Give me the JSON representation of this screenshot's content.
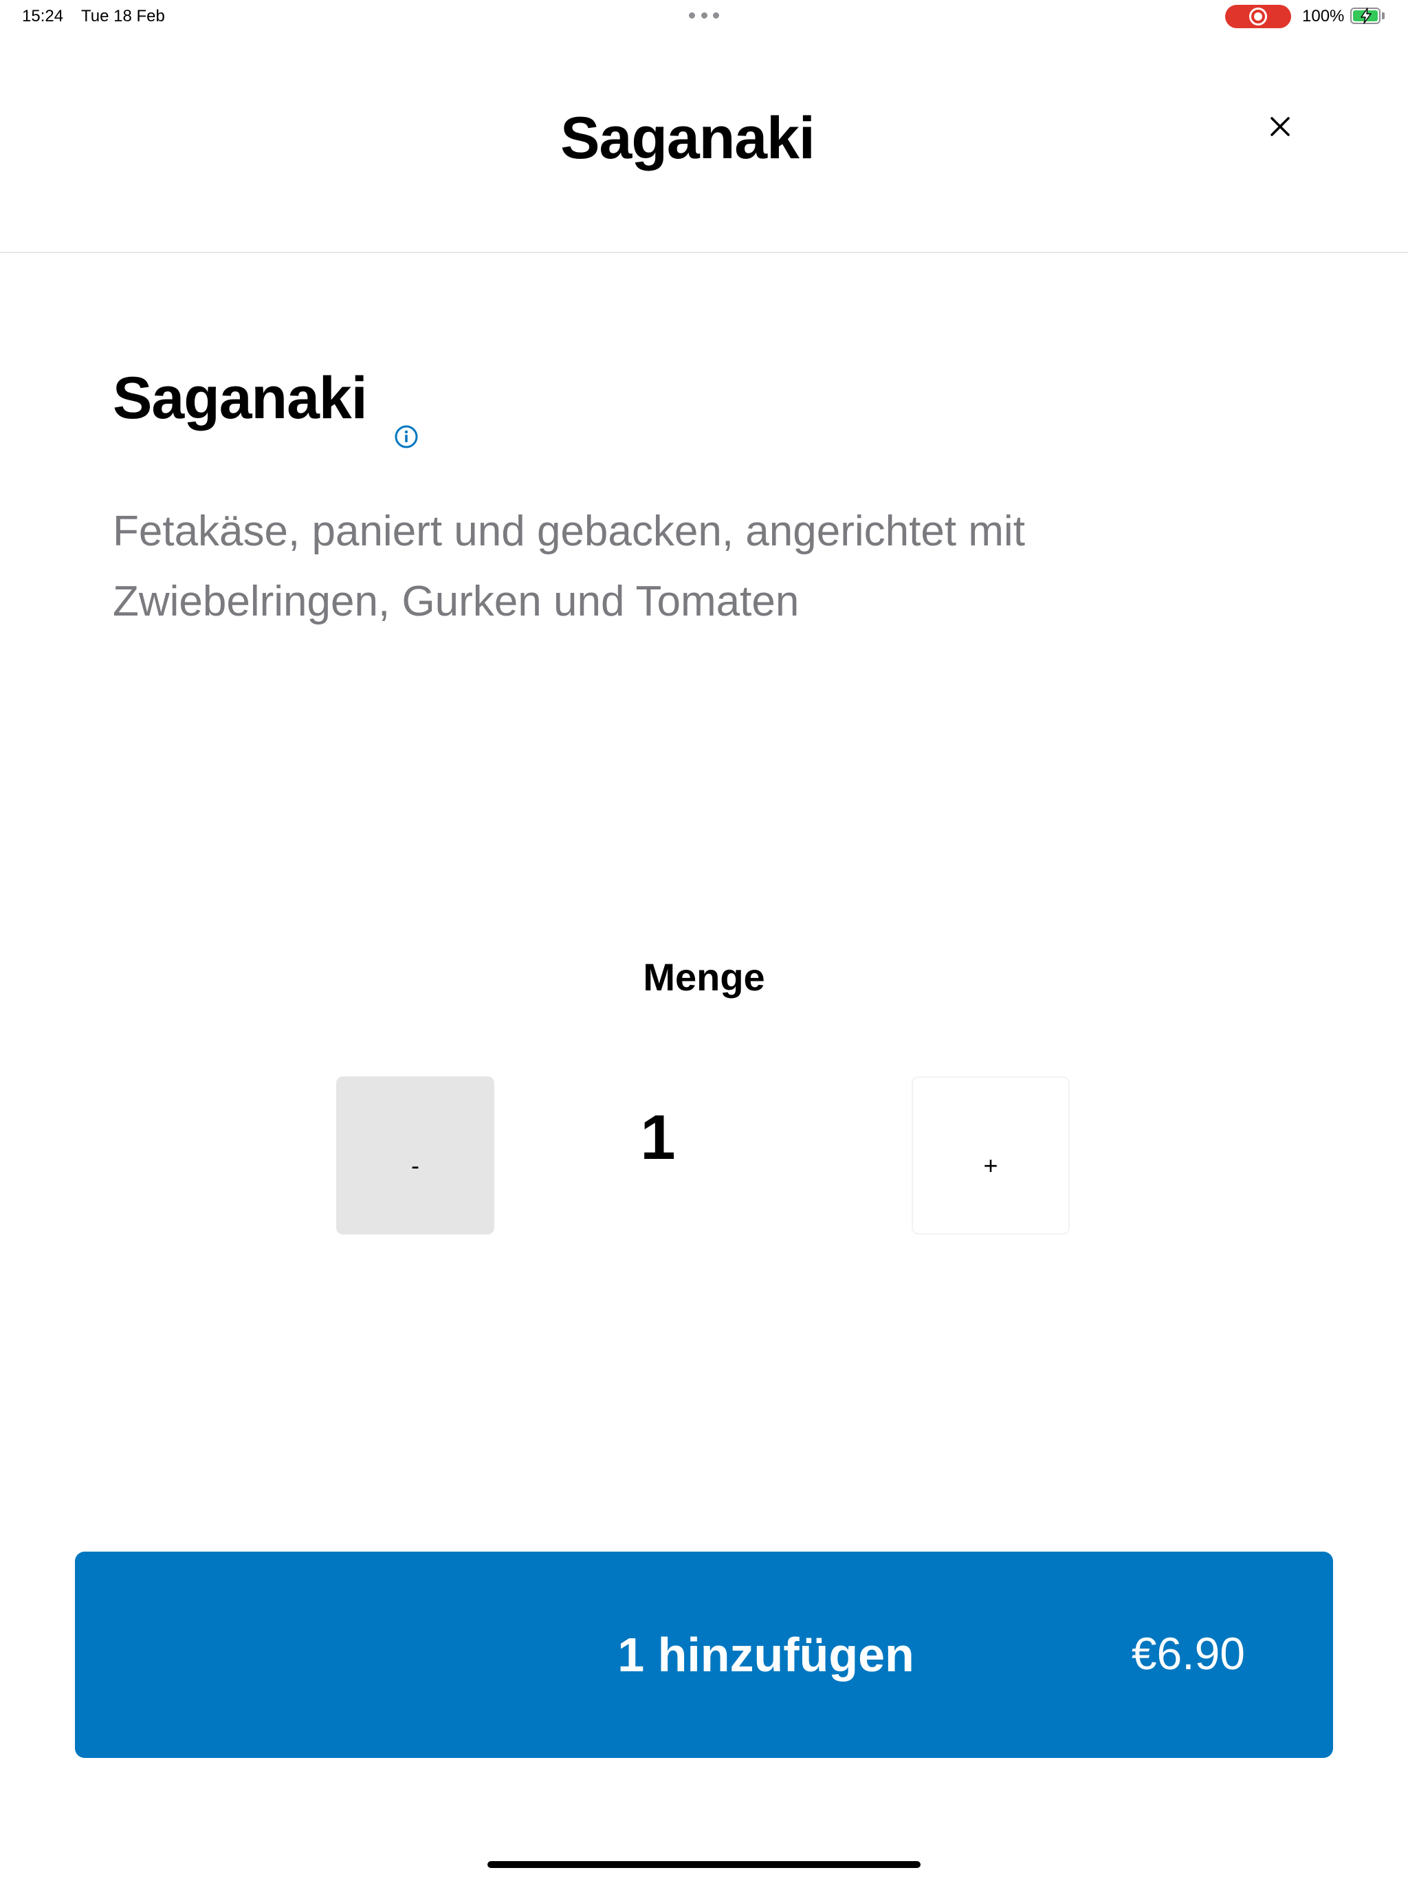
{
  "status_bar": {
    "time": "15:24",
    "date": "Tue 18 Feb",
    "battery_percent": "100%",
    "battery_level": 1.0,
    "charging": true,
    "screen_recording": true
  },
  "header": {
    "title": "Saganaki"
  },
  "product": {
    "name": "Saganaki",
    "description": "Fetakäse, paniert und gebacken, angerichtet mit Zwiebelringen, Gurken und Tomaten"
  },
  "quantity": {
    "label": "Menge",
    "minus_label": "-",
    "value": "1",
    "plus_label": "+"
  },
  "add_button": {
    "label": "1 hinzufügen",
    "price": "€6.90"
  },
  "colors": {
    "accent": "#0077c0",
    "record": "#e0352b",
    "battery": "#34c759",
    "description_text": "#7a7a7f"
  }
}
